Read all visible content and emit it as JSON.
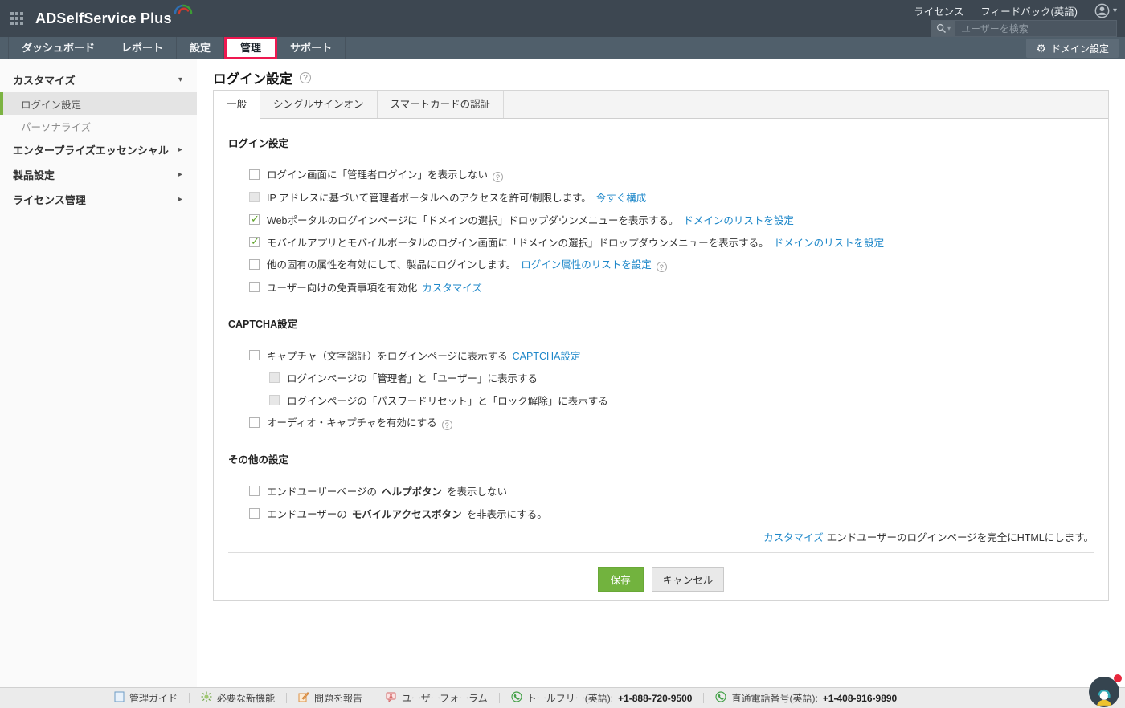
{
  "header": {
    "logo_text": "ADSelfService Plus",
    "license_label": "ライセンス",
    "feedback_label": "フィードバック(英語)",
    "search_placeholder": "ユーザーを検索",
    "domain_settings_label": "ドメイン設定"
  },
  "nav": {
    "tabs": [
      {
        "id": "dashboard",
        "label": "ダッシュボード",
        "active": false,
        "highlighted": false
      },
      {
        "id": "reports",
        "label": "レポート",
        "active": false,
        "highlighted": false
      },
      {
        "id": "configuration",
        "label": "設定",
        "active": false,
        "highlighted": false
      },
      {
        "id": "admin",
        "label": "管理",
        "active": true,
        "highlighted": true
      },
      {
        "id": "support",
        "label": "サポート",
        "active": false,
        "highlighted": false
      }
    ]
  },
  "sidebar": {
    "items": [
      {
        "id": "customize",
        "label": "カスタマイズ",
        "expanded": true,
        "children": [
          {
            "id": "login-settings",
            "label": "ログイン設定",
            "selected": true
          },
          {
            "id": "personalize",
            "label": "パーソナライズ",
            "selected": false
          }
        ]
      },
      {
        "id": "enterprise-essentials",
        "label": "エンタープライズエッセンシャル",
        "expanded": false
      },
      {
        "id": "product-settings",
        "label": "製品設定",
        "expanded": false
      },
      {
        "id": "license-management",
        "label": "ライセンス管理",
        "expanded": false
      }
    ]
  },
  "main": {
    "page_title": "ログイン設定",
    "tabs": [
      {
        "id": "general",
        "label": "一般",
        "active": true
      },
      {
        "id": "single-sign-on",
        "label": "シングルサインオン",
        "active": false
      },
      {
        "id": "smartcard-auth",
        "label": "スマートカードの認証",
        "active": false
      }
    ],
    "sections": [
      {
        "title": "ログイン設定",
        "rows": [
          {
            "checked": false,
            "disabled": false,
            "indent": 0,
            "parts": [
              {
                "type": "text",
                "value": "ログイン画面に「管理者ログイン」を表示しない"
              },
              {
                "type": "help"
              }
            ]
          },
          {
            "checked": false,
            "disabled": true,
            "indent": 0,
            "parts": [
              {
                "type": "text",
                "value": "IP アドレスに基づいて管理者ポータルへのアクセスを許可/制限します。"
              },
              {
                "type": "link",
                "value": "今すぐ構成"
              }
            ]
          },
          {
            "checked": true,
            "disabled": false,
            "indent": 0,
            "parts": [
              {
                "type": "text",
                "value": "Webポータルのログインページに「ドメインの選択」ドロップダウンメニューを表示する。"
              },
              {
                "type": "link",
                "value": "ドメインのリストを設定"
              }
            ]
          },
          {
            "checked": true,
            "disabled": false,
            "indent": 0,
            "parts": [
              {
                "type": "text",
                "value": "モバイルアプリとモバイルポータルのログイン画面に「ドメインの選択」ドロップダウンメニューを表示する。"
              },
              {
                "type": "link",
                "value": "ドメインのリストを設定"
              }
            ]
          },
          {
            "checked": false,
            "disabled": false,
            "indent": 0,
            "parts": [
              {
                "type": "text",
                "value": "他の固有の属性を有効にして、製品にログインします。"
              },
              {
                "type": "link",
                "value": "ログイン属性のリストを設定"
              },
              {
                "type": "help"
              }
            ]
          },
          {
            "checked": false,
            "disabled": false,
            "indent": 0,
            "parts": [
              {
                "type": "text",
                "value": "ユーザー向けの免責事項を有効化"
              },
              {
                "type": "link",
                "value": "カスタマイズ"
              }
            ]
          }
        ]
      },
      {
        "title": "CAPTCHA設定",
        "rows": [
          {
            "checked": false,
            "disabled": false,
            "indent": 0,
            "parts": [
              {
                "type": "text",
                "value": "キャプチャ（文字認証）をログインページに表示する"
              },
              {
                "type": "link",
                "value": "CAPTCHA設定"
              }
            ]
          },
          {
            "checked": false,
            "disabled": true,
            "indent": 1,
            "parts": [
              {
                "type": "text",
                "value": "ログインページの「管理者」と「ユーザー」に表示する"
              }
            ]
          },
          {
            "checked": false,
            "disabled": true,
            "indent": 1,
            "parts": [
              {
                "type": "text",
                "value": "ログインページの「パスワードリセット」と「ロック解除」に表示する"
              }
            ]
          },
          {
            "checked": false,
            "disabled": false,
            "indent": 0,
            "parts": [
              {
                "type": "text",
                "value": "オーディオ・キャプチャを有効にする"
              },
              {
                "type": "help"
              }
            ]
          }
        ]
      },
      {
        "title": "その他の設定",
        "rows": [
          {
            "checked": false,
            "disabled": false,
            "indent": 0,
            "parts": [
              {
                "type": "text",
                "value": "エンドユーザーページの"
              },
              {
                "type": "bold",
                "value": "ヘルプボタン"
              },
              {
                "type": "text",
                "value": "を表示しない"
              }
            ]
          },
          {
            "checked": false,
            "disabled": false,
            "indent": 0,
            "parts": [
              {
                "type": "text",
                "value": "エンドユーザーの"
              },
              {
                "type": "bold",
                "value": "モバイルアクセスボタン"
              },
              {
                "type": "text",
                "value": "を非表示にする。"
              }
            ]
          }
        ]
      }
    ],
    "note": {
      "link": "カスタマイズ",
      "text": "エンドユーザーのログインページを完全にHTMLにします。"
    },
    "save_label": "保存",
    "cancel_label": "キャンセル"
  },
  "footer": {
    "items": [
      {
        "icon": "guide-icon",
        "label": "管理ガイド"
      },
      {
        "icon": "new-features-icon",
        "label": "必要な新機能"
      },
      {
        "icon": "report-issue-icon",
        "label": "問題を報告"
      },
      {
        "icon": "user-forum-icon",
        "label": "ユーザーフォーラム"
      },
      {
        "icon": "phone-icon",
        "label": "トールフリー(英語):",
        "number": "+1-888-720-9500"
      },
      {
        "icon": "phone-icon",
        "label": "直通電話番号(英語):",
        "number": "+1-408-916-9890"
      }
    ]
  },
  "colors": {
    "header_bg": "#3d4751",
    "nav_bg": "#505f6b",
    "highlight_red": "#ee1850",
    "link_blue": "#1d87c9",
    "accent_green": "#72b33e",
    "sidebar_selected_green": "#7cb342",
    "checkbox_check_green": "#5da228"
  }
}
